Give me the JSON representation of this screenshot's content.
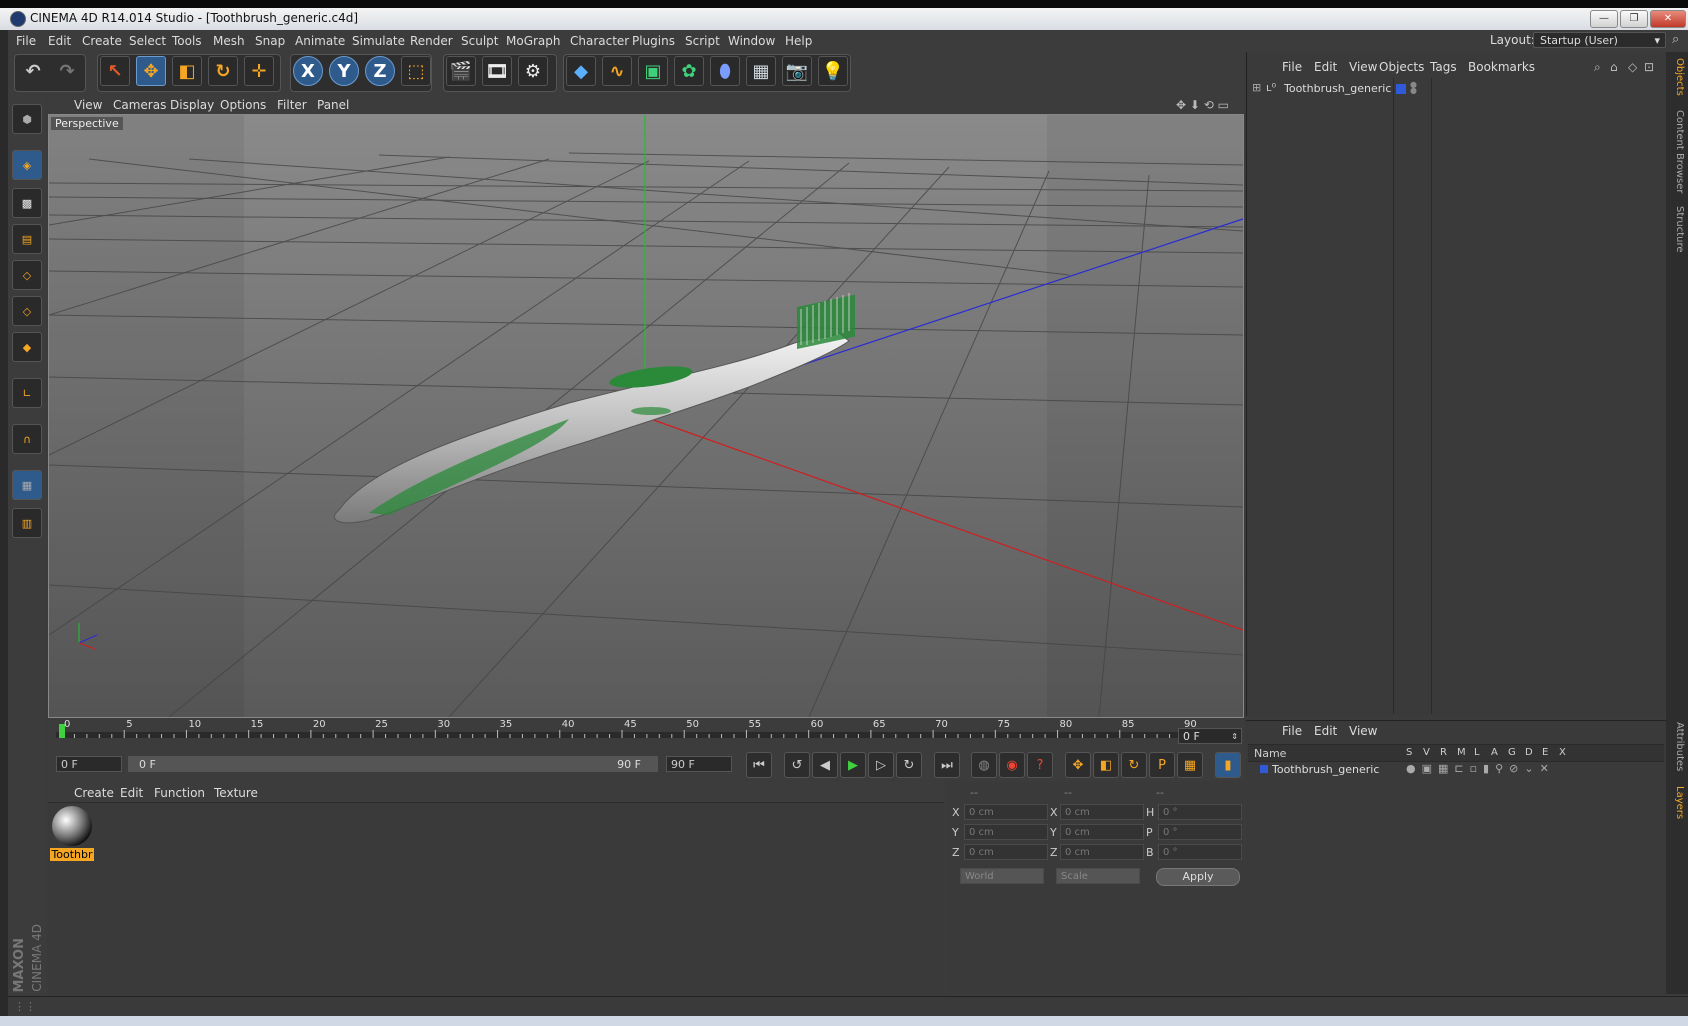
{
  "window": {
    "title": "CINEMA 4D R14.014 Studio - [Toothbrush_generic.c4d]",
    "buttons": [
      "—",
      "❐",
      "✕"
    ]
  },
  "menubar": {
    "items": [
      "File",
      "Edit",
      "Create",
      "Select",
      "Tools",
      "Mesh",
      "Snap",
      "Animate",
      "Simulate",
      "Render",
      "Sculpt",
      "MoGraph",
      "Character",
      "Plugins",
      "Script",
      "Window",
      "Help"
    ],
    "layout_label": "Layout:",
    "layout_value": "Startup (User)"
  },
  "toolbar": {
    "axis_x": "X",
    "axis_y": "Y",
    "axis_z": "Z"
  },
  "viewport": {
    "menu": [
      "View",
      "Cameras",
      "Display",
      "Options",
      "Filter",
      "Panel"
    ],
    "label": "Perspective"
  },
  "timeline": {
    "ticks": [
      "0",
      "5",
      "10",
      "15",
      "20",
      "25",
      "30",
      "35",
      "40",
      "45",
      "50",
      "55",
      "60",
      "65",
      "70",
      "75",
      "80",
      "85",
      "90"
    ],
    "current_frame": "0 F"
  },
  "playback": {
    "start_field": "0 F",
    "range_start": "0 F",
    "range_end": "90 F",
    "end_field": "90 F"
  },
  "materials": {
    "menu": [
      "Create",
      "Edit",
      "Function",
      "Texture"
    ],
    "items": [
      {
        "name": "Toothbr"
      }
    ]
  },
  "coordinates": {
    "headers": [
      "--",
      "--",
      "--"
    ],
    "rows": [
      {
        "pos_label": "X",
        "pos": "0 cm",
        "size_label": "X",
        "size": "0 cm",
        "rot_label": "H",
        "rot": "0 °"
      },
      {
        "pos_label": "Y",
        "pos": "0 cm",
        "size_label": "Y",
        "size": "0 cm",
        "rot_label": "P",
        "rot": "0 °"
      },
      {
        "pos_label": "Z",
        "pos": "0 cm",
        "size_label": "Z",
        "size": "0 cm",
        "rot_label": "B",
        "rot": "0 °"
      }
    ],
    "mode1": "World",
    "mode2": "Scale",
    "apply": "Apply"
  },
  "objects": {
    "menu": [
      "File",
      "Edit",
      "View",
      "Objects",
      "Tags",
      "Bookmarks"
    ],
    "items": [
      {
        "name": "Toothbrush_generic"
      }
    ]
  },
  "side_tabs": [
    "Objects",
    "Content Browser",
    "Structure",
    "Attributes",
    "Layers"
  ],
  "layers": {
    "menu": [
      "File",
      "Edit",
      "View"
    ],
    "columns": [
      "Name",
      "S",
      "V",
      "R",
      "M",
      "L",
      "A",
      "G",
      "D",
      "E",
      "X"
    ],
    "items": [
      {
        "name": "Toothbrush_generic"
      }
    ]
  },
  "brand": {
    "maxon": "MAXON",
    "cinema": "CINEMA 4D"
  },
  "colors": {
    "accent_blue": "#2f5b8c",
    "toothbrush_green": "#2a8a3a",
    "layer_color": "#2f5bd8"
  }
}
